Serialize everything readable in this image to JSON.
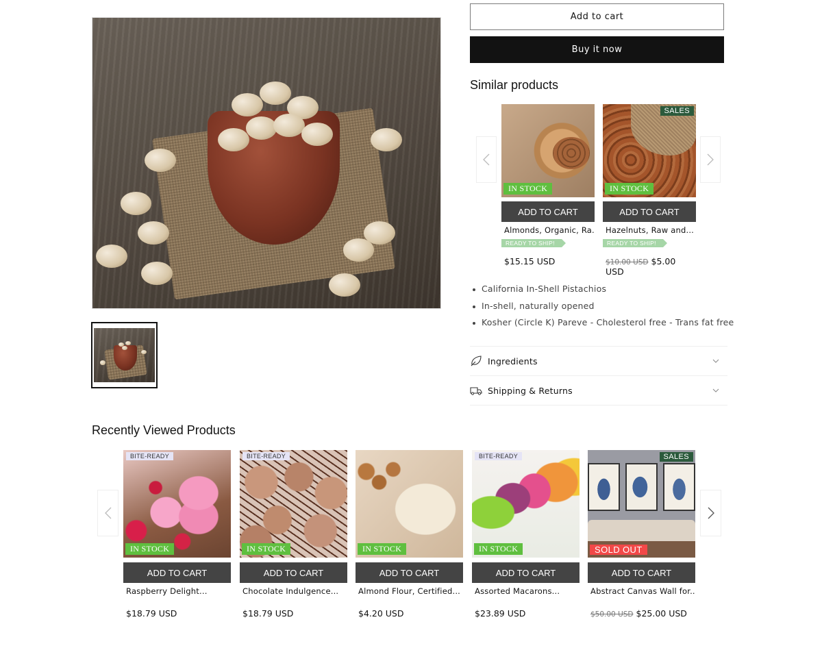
{
  "product": {
    "image_alt": "California In-Shell Pistachios in a bowl",
    "buttons": {
      "add_to_cart": "Add to cart",
      "buy_now": "Buy it now"
    },
    "features": [
      "California In-Shell Pistachios",
      "In-shell, naturally opened",
      "Kosher (Circle K) Pareve - Cholesterol free - Trans fat free"
    ],
    "accordions": [
      {
        "label": "Ingredients",
        "icon": "leaf-icon"
      },
      {
        "label": "Shipping & Returns",
        "icon": "truck-icon"
      }
    ]
  },
  "similar": {
    "title": "Similar products",
    "items": [
      {
        "name": "Almonds, Organic, Ra...",
        "stock_badge": "IN STOCK",
        "ready_badge": "READY TO SHIP!",
        "atc": "ADD TO CART",
        "price": "$15.15 USD",
        "compare_price": ""
      },
      {
        "name": "Hazelnuts, Raw and...",
        "stock_badge": "IN STOCK",
        "ready_badge": "READY TO SHIP!",
        "sale_badge": "SALES",
        "atc": "ADD TO CART",
        "price": "$5.00 USD",
        "compare_price": "$10.00 USD"
      }
    ]
  },
  "recent": {
    "title": "Recently Viewed Products",
    "items": [
      {
        "name": "Raspberry Delight...",
        "tag": "BITE-READY",
        "stock_badge": "IN STOCK",
        "atc": "ADD TO CART",
        "price": "$18.79 USD"
      },
      {
        "name": "Chocolate Indulgence...",
        "tag": "BITE-READY",
        "stock_badge": "IN STOCK",
        "atc": "ADD TO CART",
        "price": "$18.79 USD"
      },
      {
        "name": "Almond Flour, Certified...",
        "stock_badge": "IN STOCK",
        "atc": "ADD TO CART",
        "price": "$4.20 USD"
      },
      {
        "name": "Assorted Macarons...",
        "tag": "BITE-READY",
        "stock_badge": "IN STOCK",
        "atc": "ADD TO CART",
        "price": "$23.89 USD"
      },
      {
        "name": "Abstract Canvas Wall for...",
        "sale_badge": "SALES",
        "stock_badge": "SOLD OUT",
        "atc": "ADD TO CART",
        "price": "$25.00 USD",
        "compare_price": "$50.00 USD"
      }
    ]
  },
  "colors": {
    "in_stock": "#5fbf3f",
    "sold_out": "#f24848",
    "sales": "#2b5a3c",
    "ready_to_ship": "#a6d6a7",
    "add_to_cart_bg": "#444444",
    "buy_now_bg": "#121212"
  }
}
